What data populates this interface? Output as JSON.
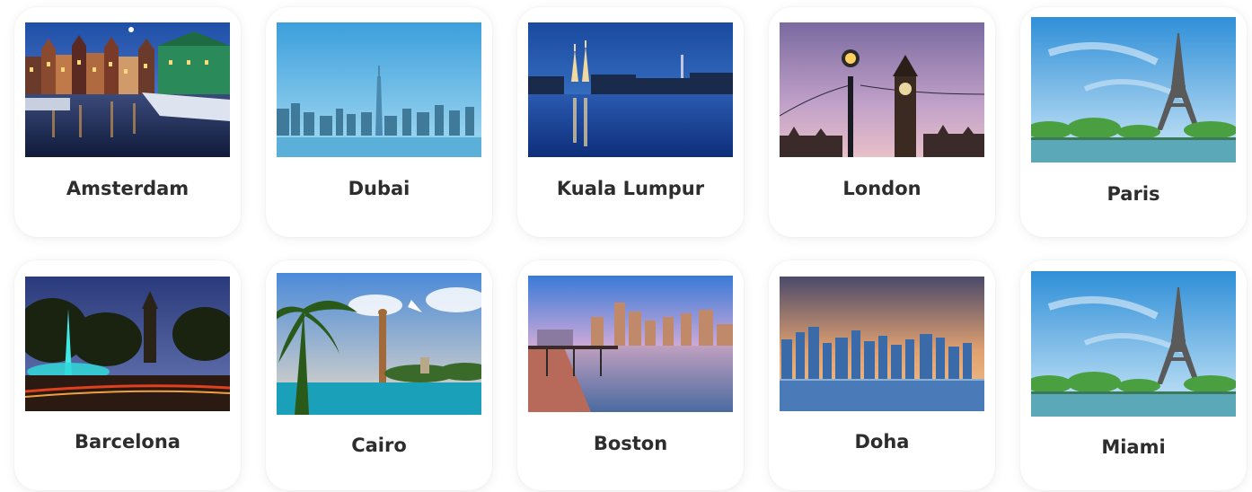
{
  "destinations": [
    {
      "name": "Amsterdam",
      "photo": "amsterdam-canal-photo"
    },
    {
      "name": "Dubai",
      "photo": "dubai-skyline-photo"
    },
    {
      "name": "Kuala Lumpur",
      "photo": "kuala-lumpur-towers-photo"
    },
    {
      "name": "London",
      "photo": "london-big-ben-photo"
    },
    {
      "name": "Paris",
      "photo": "paris-eiffel-tower-photo"
    },
    {
      "name": "Barcelona",
      "photo": "barcelona-fountain-photo"
    },
    {
      "name": "Cairo",
      "photo": "cairo-nile-photo"
    },
    {
      "name": "Boston",
      "photo": "boston-harbor-photo"
    },
    {
      "name": "Doha",
      "photo": "doha-skyline-photo"
    },
    {
      "name": "Miami",
      "photo": "miami-eiffel-tower-photo"
    }
  ]
}
